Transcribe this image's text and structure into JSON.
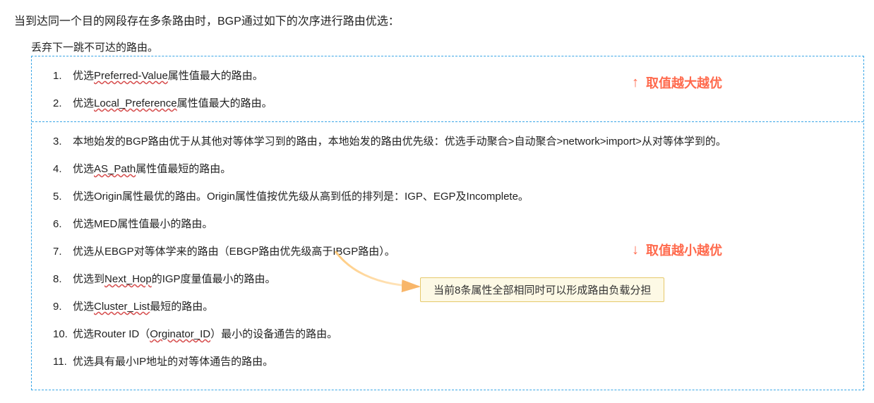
{
  "title": "当到达同一个目的网段存在多条路由时，BGP通过如下的次序进行路由优选：",
  "discard": "丢弃下一跳不可达的路由。",
  "annotations": {
    "top_arrow": "↑",
    "top_text": "取值越大越优",
    "bottom_arrow": "↓",
    "bottom_text": "取值越小越优"
  },
  "callout": "当前8条属性全部相同时可以形成路由负载分担",
  "top_items": [
    {
      "num": "1.",
      "prefix": "优选",
      "squiggle": "Preferred-Value",
      "suffix": "属性值最大的路由。"
    },
    {
      "num": "2.",
      "prefix": "优选",
      "squiggle": "Local_Preference",
      "suffix": "属性值最大的路由。"
    }
  ],
  "bottom_items": [
    {
      "num": "3.",
      "text": "本地始发的BGP路由优于从其他对等体学习到的路由，本地始发的路由优先级：优选手动聚合>自动聚合>network>import>从对等体学到的。"
    },
    {
      "num": "4.",
      "prefix": "优选",
      "squiggle": "AS_Path",
      "suffix": "属性值最短的路由。"
    },
    {
      "num": "5.",
      "text": "优选Origin属性最优的路由。Origin属性值按优先级从高到低的排列是：IGP、EGP及Incomplete。"
    },
    {
      "num": "6.",
      "text": "优选MED属性值最小的路由。"
    },
    {
      "num": "7.",
      "text": "优选从EBGP对等体学来的路由（EBGP路由优先级高于IBGP路由）。"
    },
    {
      "num": "8.",
      "prefix": "优选到",
      "squiggle": "Next_Hop",
      "suffix": "的IGP度量值最小的路由。"
    },
    {
      "num": "9.",
      "prefix": "优选",
      "squiggle": "Cluster_List",
      "suffix": "最短的路由。"
    },
    {
      "num": "10.",
      "prefix": "优选Router ID（",
      "squiggle": "Orginator_ID",
      "suffix": "）最小的设备通告的路由。"
    },
    {
      "num": "11.",
      "text": "优选具有最小IP地址的对等体通告的路由。"
    }
  ]
}
